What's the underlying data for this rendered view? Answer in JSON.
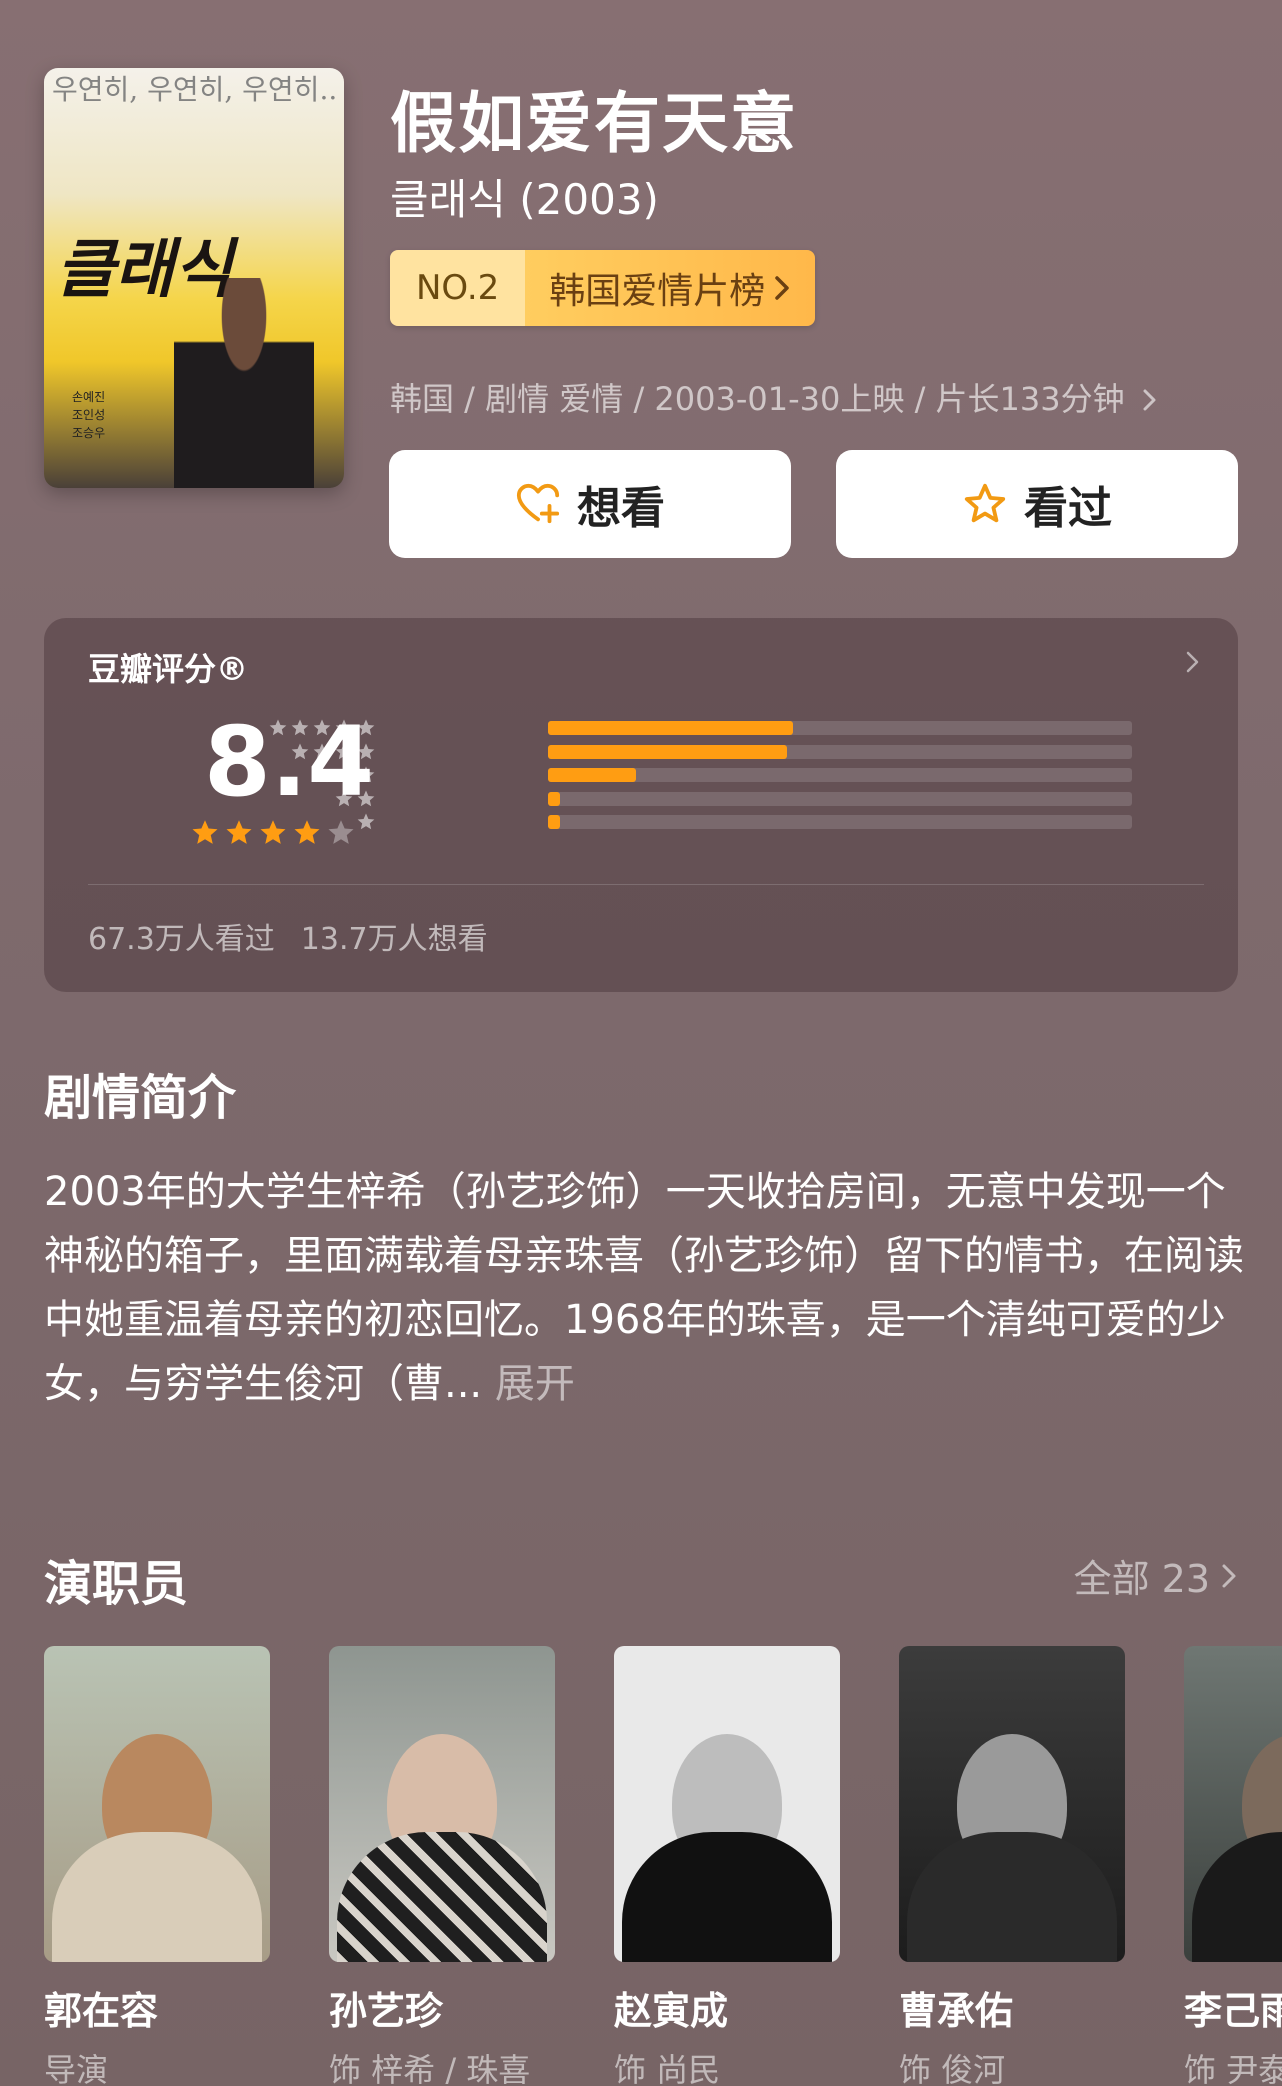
{
  "movie": {
    "title": "假如爱有天意",
    "original_title": "클래식 (2003)",
    "rank_no": "NO.2",
    "rank_list": "韩国爱情片榜",
    "meta": "韩国 / 剧情 爱情 / 2003-01-30上映 / 片长133分钟",
    "poster": {
      "top_text": "우연히, 우연히, 우연히... 그러나... 반드시",
      "logo": "클래식",
      "credits": [
        "손예진",
        "조인성",
        "조승우"
      ]
    }
  },
  "actions": {
    "want_label": "想看",
    "seen_label": "看过"
  },
  "rating": {
    "header": "豆瓣评分®",
    "score": "8.4",
    "stars_filled": 4,
    "stars_total": 5,
    "distribution": [
      {
        "stars": 5,
        "fraction": 0.42
      },
      {
        "stars": 4,
        "fraction": 0.41
      },
      {
        "stars": 3,
        "fraction": 0.15
      },
      {
        "stars": 2,
        "fraction": 0.02
      },
      {
        "stars": 1,
        "fraction": 0.02
      }
    ],
    "seen_count": "67.3万人看过",
    "want_count": "13.7万人想看"
  },
  "synopsis": {
    "title": "剧情简介",
    "text": "2003年的大学生梓希（孙艺珍饰）一天收拾房间，无意中发现一个神秘的箱子，里面满载着母亲珠喜（孙艺珍饰）留下的情书，在阅读中她重温着母亲的初恋回忆。1968年的珠喜，是一个清纯可爱的少女，与穷学生俊河（曹...",
    "expand_label": "展开"
  },
  "cast": {
    "title": "演职员",
    "all_label": "全部 23",
    "members": [
      {
        "name": "郭在容",
        "role": "导演"
      },
      {
        "name": "孙艺珍",
        "role": "饰 梓希 / 珠喜"
      },
      {
        "name": "赵寅成",
        "role": "饰 尚民"
      },
      {
        "name": "曹承佑",
        "role": "饰 俊河"
      },
      {
        "name": "李己雨",
        "role": "饰 尹泰"
      }
    ]
  },
  "colors": {
    "accent_orange": "#ff9d12",
    "star_orange": "#ff9d12",
    "rank_gold": "#ffcd5f"
  }
}
